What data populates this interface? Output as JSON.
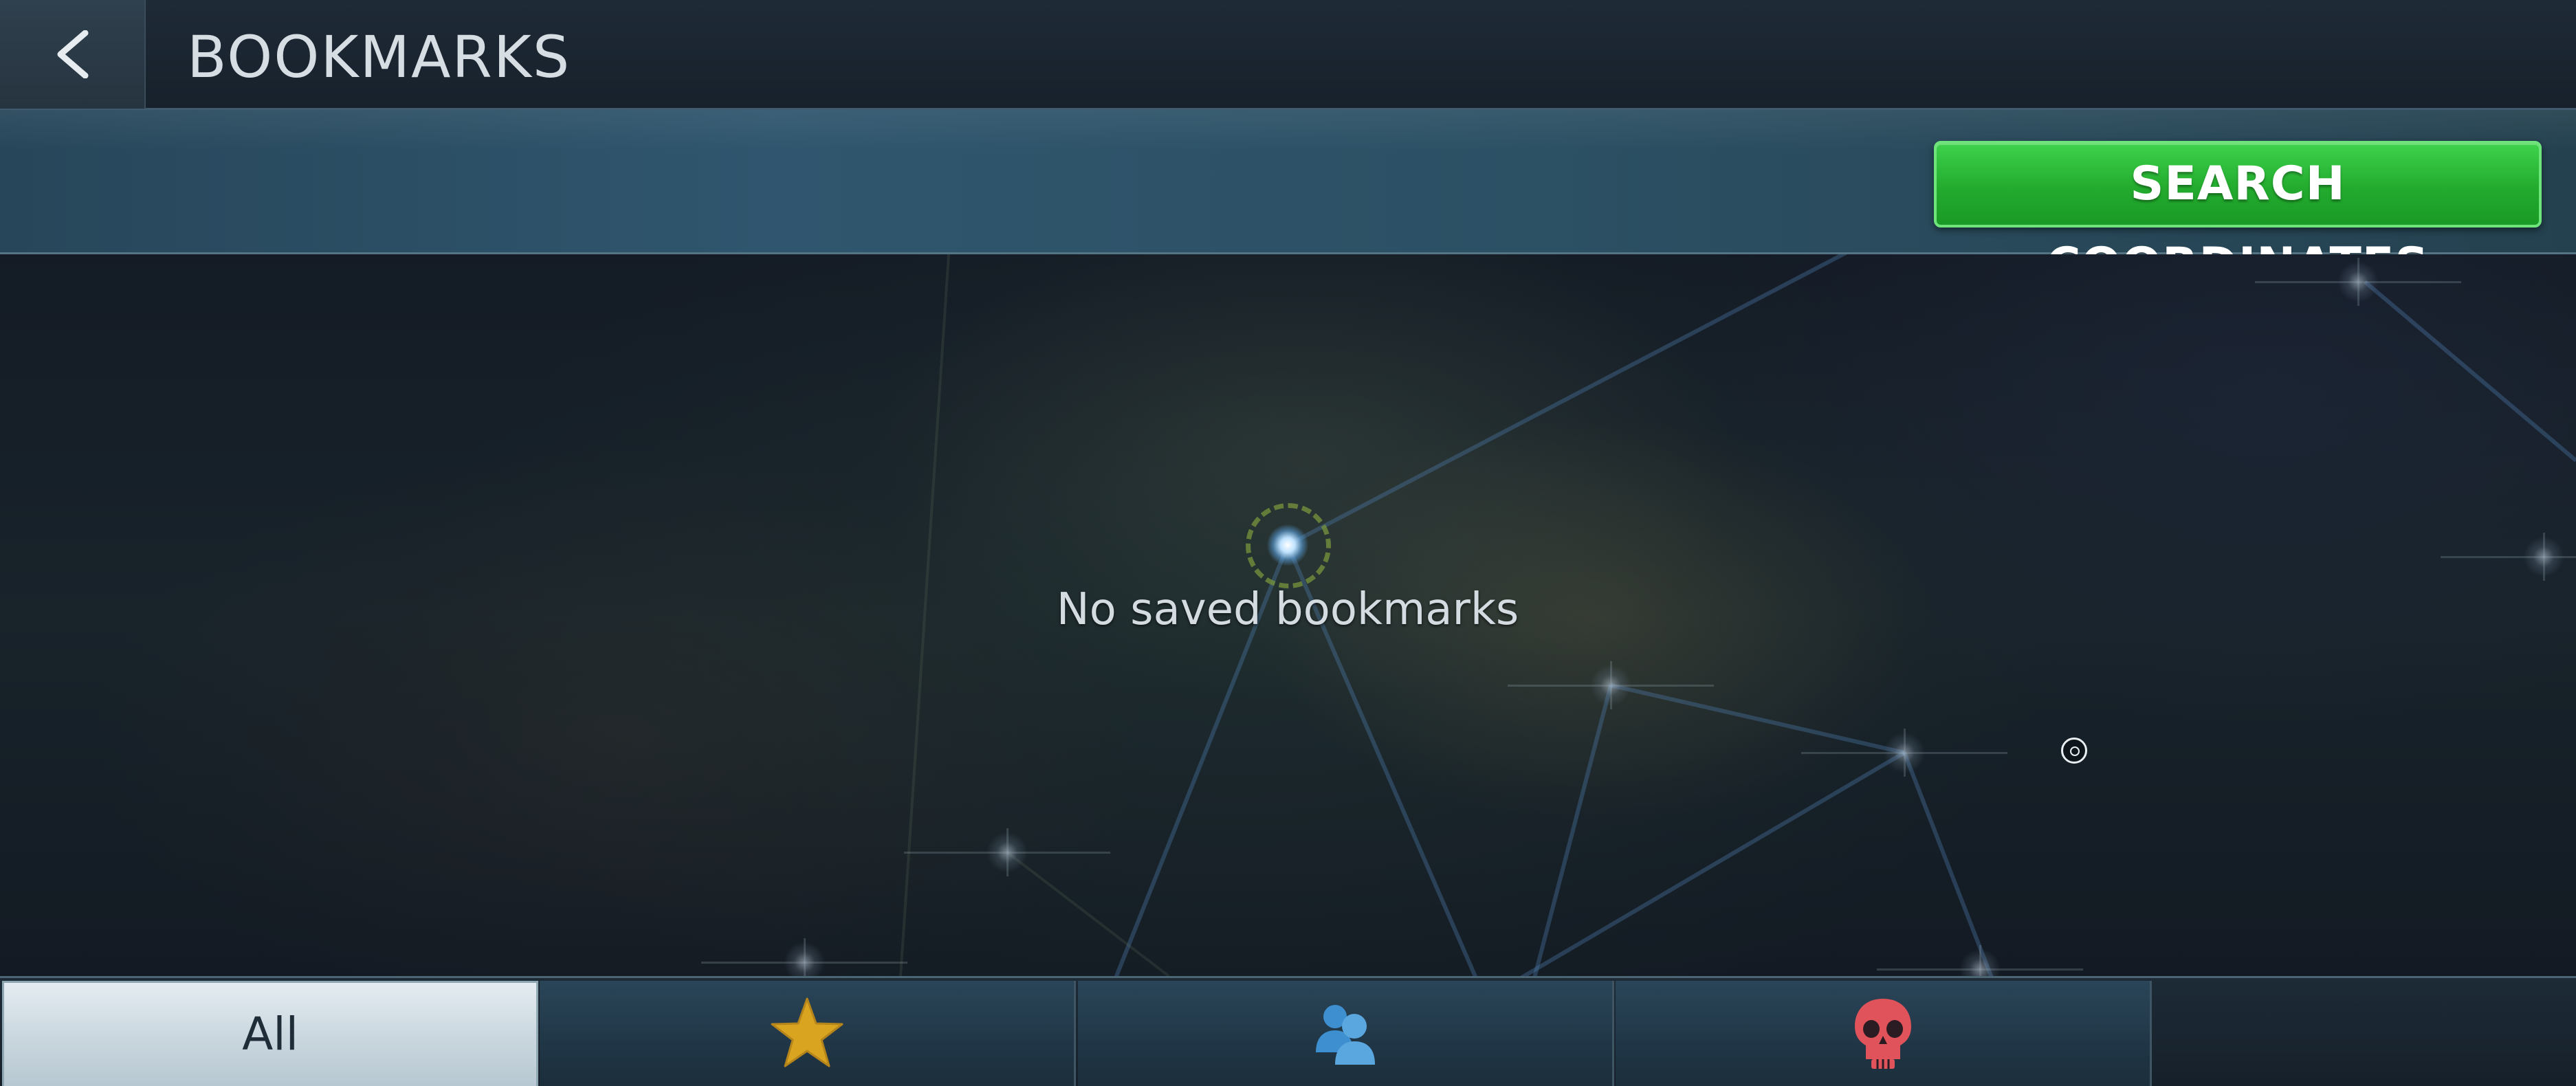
{
  "header": {
    "title": "BOOKMARKS",
    "back_icon": "chevron-left-icon"
  },
  "toolbar": {
    "search_label": "SEARCH COORDINATES"
  },
  "main": {
    "empty_message": "No saved bookmarks"
  },
  "tabs": [
    {
      "label": "All",
      "icon": null,
      "active": true
    },
    {
      "label": "",
      "icon": "star-icon",
      "active": false
    },
    {
      "label": "",
      "icon": "users-icon",
      "active": false
    },
    {
      "label": "",
      "icon": "skull-icon",
      "active": false
    }
  ],
  "colors": {
    "accent_green": "#23ab2e",
    "star_gold": "#d9a521",
    "users_blue": "#3d8fd0",
    "skull_red": "#e0535a",
    "header_bg": "#1e2a36",
    "subbar_bg": "#2f566e"
  }
}
